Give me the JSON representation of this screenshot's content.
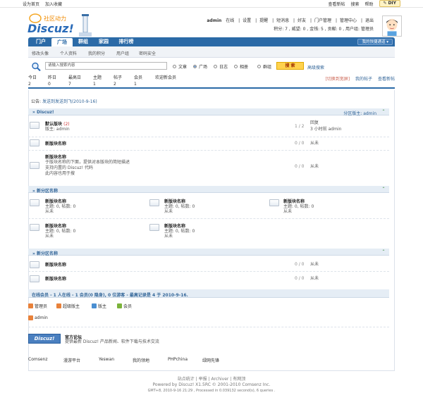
{
  "topbar": {
    "left": [
      "设为首页",
      "加入收藏"
    ],
    "right": [
      "查看新帖",
      "搜索",
      "帮助"
    ],
    "diy": "DIY"
  },
  "user": {
    "name": "admin",
    "status": "在线",
    "links": [
      "设置",
      "提醒",
      "短消息",
      "好友",
      "门户管理",
      "管理中心",
      "退出"
    ],
    "stats": "积分: 7 , 威望: 0 , 金钱: 5 , 贡献: 0 , 用户组: 管理员"
  },
  "logo": {
    "text": "Discuz!",
    "slogan": "社区动力"
  },
  "nav": {
    "items": [
      "门户",
      "广场",
      "群组",
      "家园",
      "排行榜"
    ],
    "active": 1,
    "quick": "我的快捷通道"
  },
  "subnav": [
    "修改头像",
    "个人资料",
    "我的积分",
    "用户组",
    "密码安全"
  ],
  "search": {
    "placeholder": "请输入搜索内容",
    "options": [
      "文章",
      "广场",
      "日志",
      "相册",
      "群组",
      "用户"
    ],
    "selected": 1,
    "button": "搜 索",
    "advanced": "高级搜索"
  },
  "stats": {
    "cols": [
      {
        "label": "今日",
        "value": "2"
      },
      {
        "label": "昨日",
        "value": "0"
      },
      {
        "label": "最高日",
        "value": "7"
      },
      {
        "label": "主题",
        "value": "1"
      },
      {
        "label": "帖子",
        "value": "2"
      },
      {
        "label": "会员",
        "value": "1"
      }
    ],
    "welcome": "欢迎新会员",
    "links": [
      "[切换到宽屏]",
      "我的帖子",
      "查看新帖"
    ]
  },
  "notice": {
    "label": "公告:",
    "text": "发送到发送到飞(2010-9-16)"
  },
  "sections": [
    {
      "title": "Discuz!",
      "mods": "分区版主: admin"
    },
    {
      "title": "新分区名称"
    },
    {
      "title": "新分区名称"
    }
  ],
  "forums": {
    "f1": {
      "name": "默认版块",
      "new": "(2)",
      "mod": "版主: admin",
      "count": "1 / 2",
      "last_title": "回复",
      "last_info": "3 小时前 admin"
    },
    "f2": {
      "name": "新版块名称",
      "count": "0 / 0",
      "last": "从未"
    },
    "f3": {
      "name": "新版块名称",
      "desc": [
        "于版块名称的下面，提供对本版块的简短描述",
        "支持内置的 Discuz! 代码",
        "此内容也用于搜"
      ],
      "count": "0 / 0",
      "last": "从未"
    },
    "grid_name": "新版块名称",
    "grid_stats": "主题: 0, 帖数: 0",
    "grid_last": "从未",
    "f8": {
      "name": "新版块名称",
      "count": "0 / 0",
      "last": "从未"
    },
    "f9": {
      "name": "新版块名称",
      "count": "0 / 0",
      "last": "从未"
    }
  },
  "online": {
    "title": "在线会员 - 1 人在线 - 1 会员(0 隐身), 0 位游客 - 最高记录是 4 于 2010-9-16.",
    "legend": [
      {
        "label": "管理员",
        "color": "#e8813a"
      },
      {
        "label": "超级版主",
        "color": "#e8813a"
      },
      {
        "label": "版主",
        "color": "#4a8fd1"
      },
      {
        "label": "会员",
        "color": "#7bb33a"
      }
    ],
    "user": "admin"
  },
  "official": {
    "title": "官方论坛",
    "desc": "提供最新 Discuz! 产品新闻、软件下载与技术交流",
    "logo": "Discuz!"
  },
  "footer_links": [
    "Comsenz",
    "漫游平台",
    "Yeswan",
    "我的领地",
    "PHPchina",
    "绿网先锋"
  ],
  "footer": {
    "links": "站点统计 | 举报 | Archiver | 有网顶",
    "powered": "Powered by Discuz! X1.5RC © 2001-2010 Comsenz Inc.",
    "gmt": "GMT+8, 2010-9-16 21:29 , Processed in 0.039132 second(s), 6 queries ."
  }
}
